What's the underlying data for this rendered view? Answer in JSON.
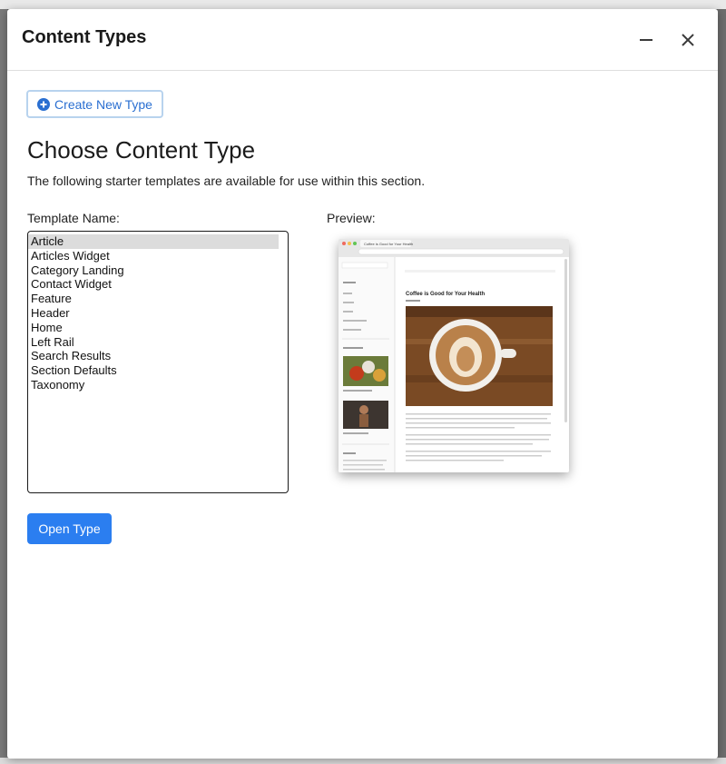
{
  "dialog": {
    "title": "Content Types",
    "minimize_icon": "minus-icon",
    "close_icon": "close-icon"
  },
  "toolbar": {
    "create_label": "Create New Type",
    "create_icon": "plus-circle-icon"
  },
  "main": {
    "heading": "Choose Content Type",
    "description": "The following starter templates are available for use within this section.",
    "template_label": "Template Name:",
    "preview_label": "Preview:",
    "templates": [
      "Article",
      "Articles Widget",
      "Category Landing",
      "Contact Widget",
      "Feature",
      "Header",
      "Home",
      "Left Rail",
      "Search Results",
      "Section Defaults",
      "Taxonomy"
    ],
    "selected_template": "Article",
    "open_label": "Open Type"
  },
  "preview": {
    "browser_tab": "Coffee is Good for Your Health",
    "article_title": "Coffee is Good for Your Health"
  },
  "colors": {
    "accent": "#2b7ef0",
    "link": "#2a6fd1",
    "outline": "#b8d3ee"
  }
}
